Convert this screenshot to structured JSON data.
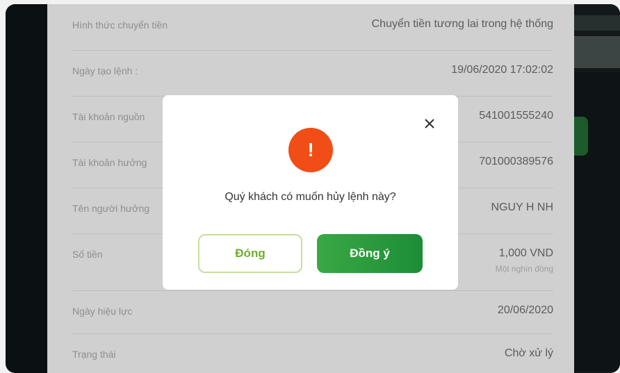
{
  "details": {
    "rows": [
      {
        "label": "Hình thức chuyển tiền",
        "value": "Chuyển tiền tương lai trong hệ thống"
      },
      {
        "label": "Ngày tạo lệnh :",
        "value": "19/06/2020 17:02:02"
      },
      {
        "label": "Tài khoản nguồn",
        "value": "541001555240"
      },
      {
        "label": "Tài khoản hưởng",
        "value": "701000389576"
      },
      {
        "label": "Tên người hưởng",
        "value": "NGUY H NH"
      },
      {
        "label": "Số tiền",
        "value": "1,000 VND",
        "subvalue": "Một nghìn đồng"
      },
      {
        "label": "Ngày hiệu lực",
        "value": "20/06/2020"
      },
      {
        "label": "Trạng thái",
        "value": "Chờ xử lý"
      }
    ]
  },
  "modal": {
    "icon": "exclamation-icon",
    "icon_glyph": "!",
    "icon_color": "#f04e16",
    "close_glyph": "✕",
    "message": "Quý khách có muốn hủy lệnh này?",
    "cancel_label": "Đóng",
    "confirm_label": "Đồng ý",
    "accent_color": "#2a9a3d"
  }
}
